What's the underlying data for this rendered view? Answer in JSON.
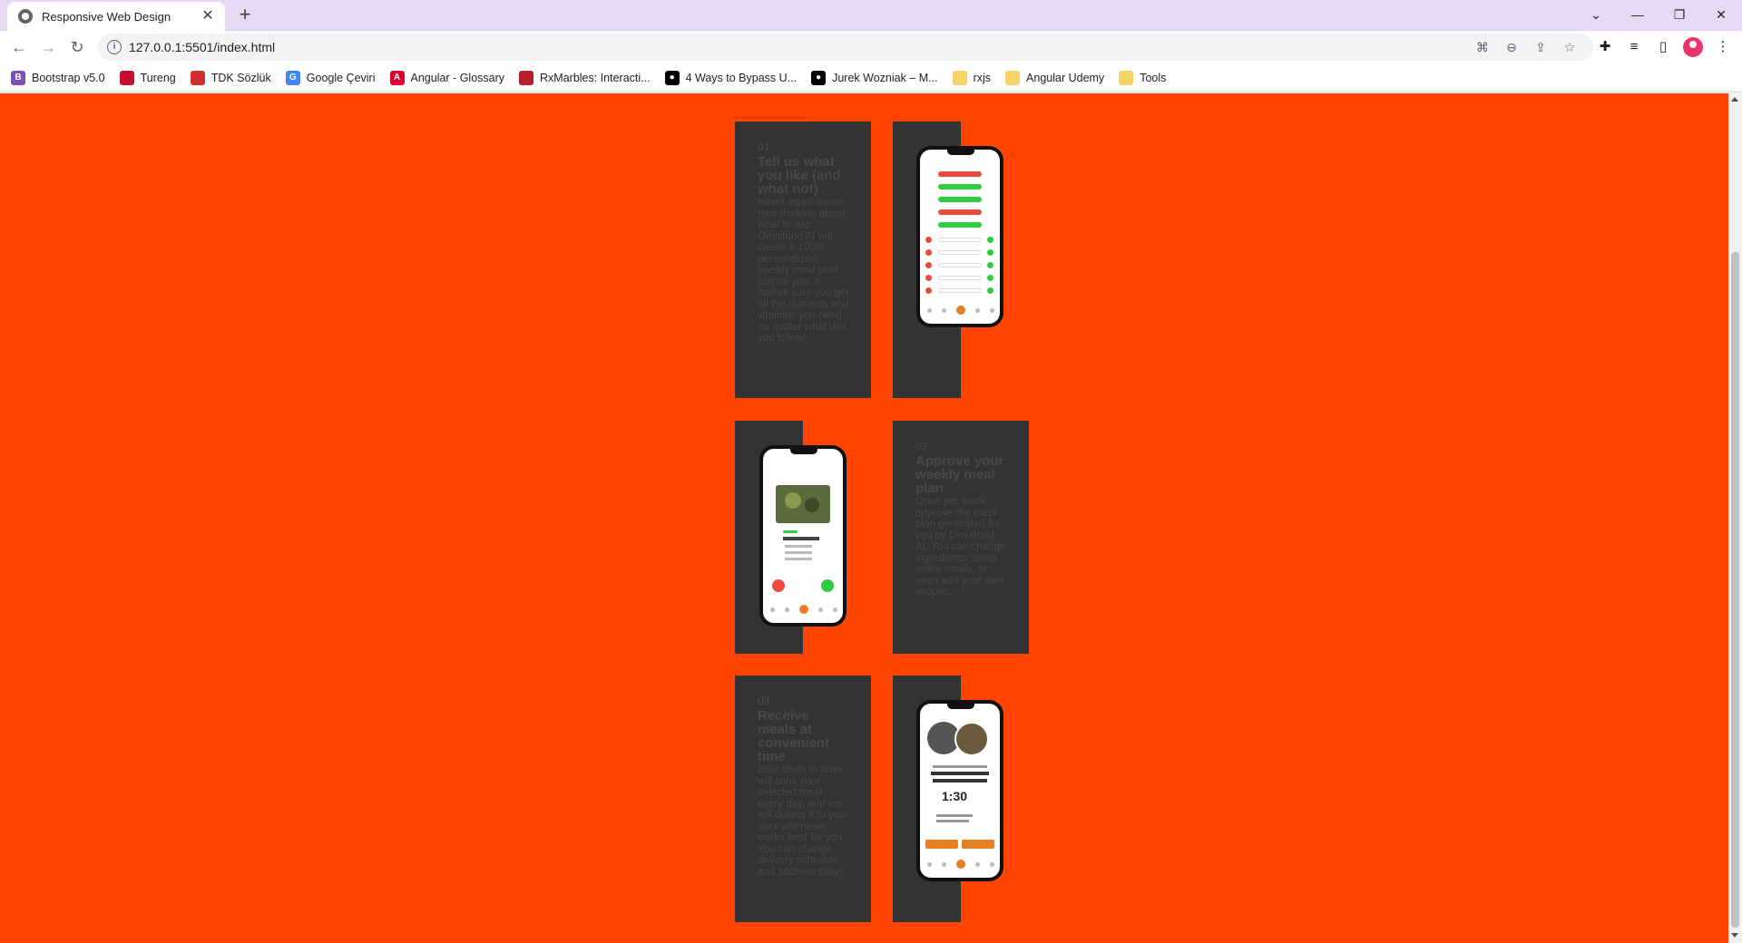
{
  "browser": {
    "tab_title": "Responsive Web Design",
    "url": "127.0.0.1:5501/index.html",
    "bookmarks": [
      {
        "label": "Bootstrap v5.0",
        "icon": "bootstrap-icon",
        "color": "#7952b3",
        "glyph": "B"
      },
      {
        "label": "Tureng",
        "icon": "tureng-icon",
        "color": "#c8102e",
        "glyph": ""
      },
      {
        "label": "TDK Sözlük",
        "icon": "tdk-icon",
        "color": "#d0312d",
        "glyph": ""
      },
      {
        "label": "Google Çeviri",
        "icon": "google-translate-icon",
        "color": "#4285f4",
        "glyph": "G"
      },
      {
        "label": "Angular - Glossary",
        "icon": "angular-icon",
        "color": "#dd0031",
        "glyph": "A"
      },
      {
        "label": "RxMarbles: Interacti...",
        "icon": "rxmarbles-icon",
        "color": "#b7202a",
        "glyph": ""
      },
      {
        "label": "4 Ways to Bypass U...",
        "icon": "medium-icon",
        "color": "#000000",
        "glyph": "●"
      },
      {
        "label": "Jurek Wozniak – M...",
        "icon": "medium-icon",
        "color": "#000000",
        "glyph": "●"
      },
      {
        "label": "rxjs",
        "icon": "folder-icon",
        "color": "#f6d365",
        "glyph": ""
      },
      {
        "label": "Angular Udemy",
        "icon": "folder-icon",
        "color": "#f6d365",
        "glyph": ""
      },
      {
        "label": "Tools",
        "icon": "folder-icon",
        "color": "#f6d365",
        "glyph": ""
      }
    ]
  },
  "page": {
    "background": "#ff4500",
    "card_color": "#333333",
    "steps": [
      {
        "number": "01",
        "title": "Tell us what you like (and what not)",
        "text": "Never again waste time thinking about what to eat! Omnifood AI will create a 100% personalized weekly meal plan just for you. It makes sure you get all the nutrients and vitamins you need, no matter what diet you follow!"
      },
      {
        "number": "02",
        "title": "Approve your weekly meal plan",
        "text": "Once per week, approve the meal plan generated for you by Omnifood AI. You can change ingredients, swap entire meals, or even add your own recipes."
      },
      {
        "number": "03",
        "title": "Receive meals at convenient time",
        "text": "Best chefs in town will cook your selected meal every day, and we will deliver it to your door whenever works best for you. You can change delivery schedule and address daily!"
      }
    ],
    "phone_time": "1:30"
  }
}
